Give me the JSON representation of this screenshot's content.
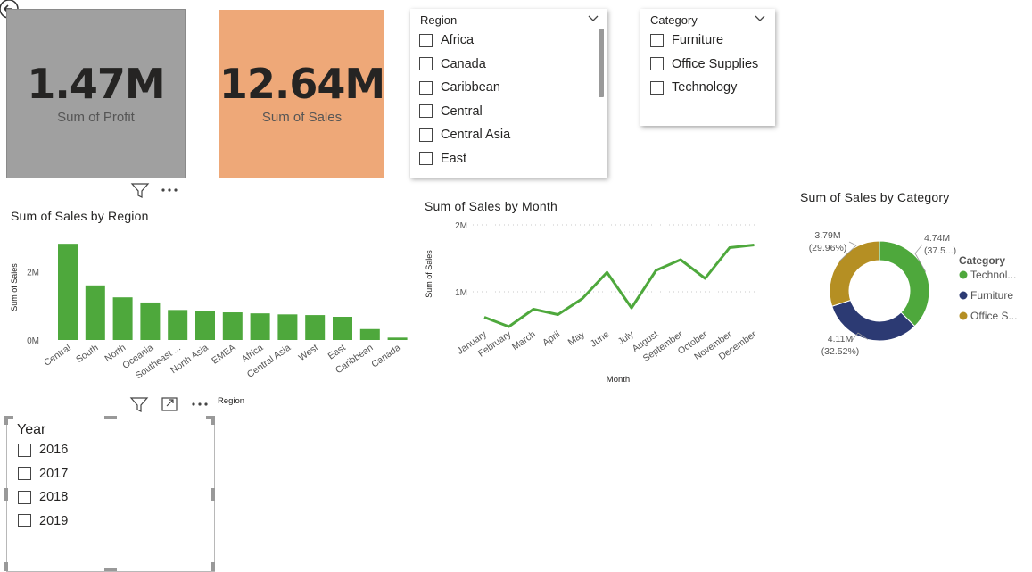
{
  "cards": {
    "profit": {
      "value": "1.47M",
      "label": "Sum of Profit"
    },
    "sales": {
      "value": "12.64M",
      "label": "Sum of Sales"
    }
  },
  "region_slicer": {
    "header": "Region",
    "items": [
      "Africa",
      "Canada",
      "Caribbean",
      "Central",
      "Central Asia",
      "East"
    ]
  },
  "category_slicer": {
    "header": "Category",
    "items": [
      "Furniture",
      "Office Supplies",
      "Technology"
    ]
  },
  "year_slicer": {
    "header": "Year",
    "items": [
      "2016",
      "2017",
      "2018",
      "2019"
    ]
  },
  "colors": {
    "green": "#4ea83c",
    "navy": "#2c3a73",
    "gold": "#b58f23",
    "profit_card": "#a0a0a0",
    "sales_card": "#eea878"
  },
  "chart_data": [
    {
      "type": "bar",
      "title": "Sum of Sales by Region",
      "xlabel": "Region",
      "ylabel": "Sum of Sales",
      "yticks": [
        "0M",
        "2M"
      ],
      "ylim": [
        0,
        3.4
      ],
      "categories": [
        "Central",
        "South",
        "North",
        "Oceania",
        "Southeast ...",
        "North Asia",
        "EMEA",
        "Africa",
        "Central Asia",
        "West",
        "East",
        "Caribbean",
        "Canada"
      ],
      "values": [
        2.82,
        1.6,
        1.25,
        1.1,
        0.88,
        0.85,
        0.81,
        0.78,
        0.75,
        0.73,
        0.68,
        0.32,
        0.07
      ],
      "color": "#4ea83c"
    },
    {
      "type": "line",
      "title": "Sum of Sales by Month",
      "xlabel": "Month",
      "ylabel": "Sum of Sales",
      "yticks": [
        "1M",
        "2M"
      ],
      "ylim": [
        0,
        2.5
      ],
      "x": [
        "January",
        "February",
        "March",
        "April",
        "May",
        "June",
        "July",
        "August",
        "September",
        "October",
        "November",
        "December"
      ],
      "values": [
        0.62,
        0.48,
        0.74,
        0.66,
        0.9,
        1.29,
        0.76,
        1.32,
        1.48,
        1.2,
        1.66,
        1.7
      ],
      "color": "#4ea83c"
    },
    {
      "type": "pie",
      "title": "Sum of Sales by Category",
      "legend_title": "Category",
      "legend": [
        "Technol...",
        "Furniture",
        "Office S..."
      ],
      "series": [
        {
          "name": "Technology",
          "value": 4.74,
          "label": "4.74M",
          "pct": "(37.5...)",
          "color": "#4ea83c"
        },
        {
          "name": "Furniture",
          "value": 4.11,
          "label": "4.11M",
          "pct": "(32.52%)",
          "color": "#2c3a73"
        },
        {
          "name": "Office Supplies",
          "value": 3.79,
          "label": "3.79M",
          "pct": "(29.96%)",
          "color": "#b58f23"
        }
      ]
    }
  ]
}
